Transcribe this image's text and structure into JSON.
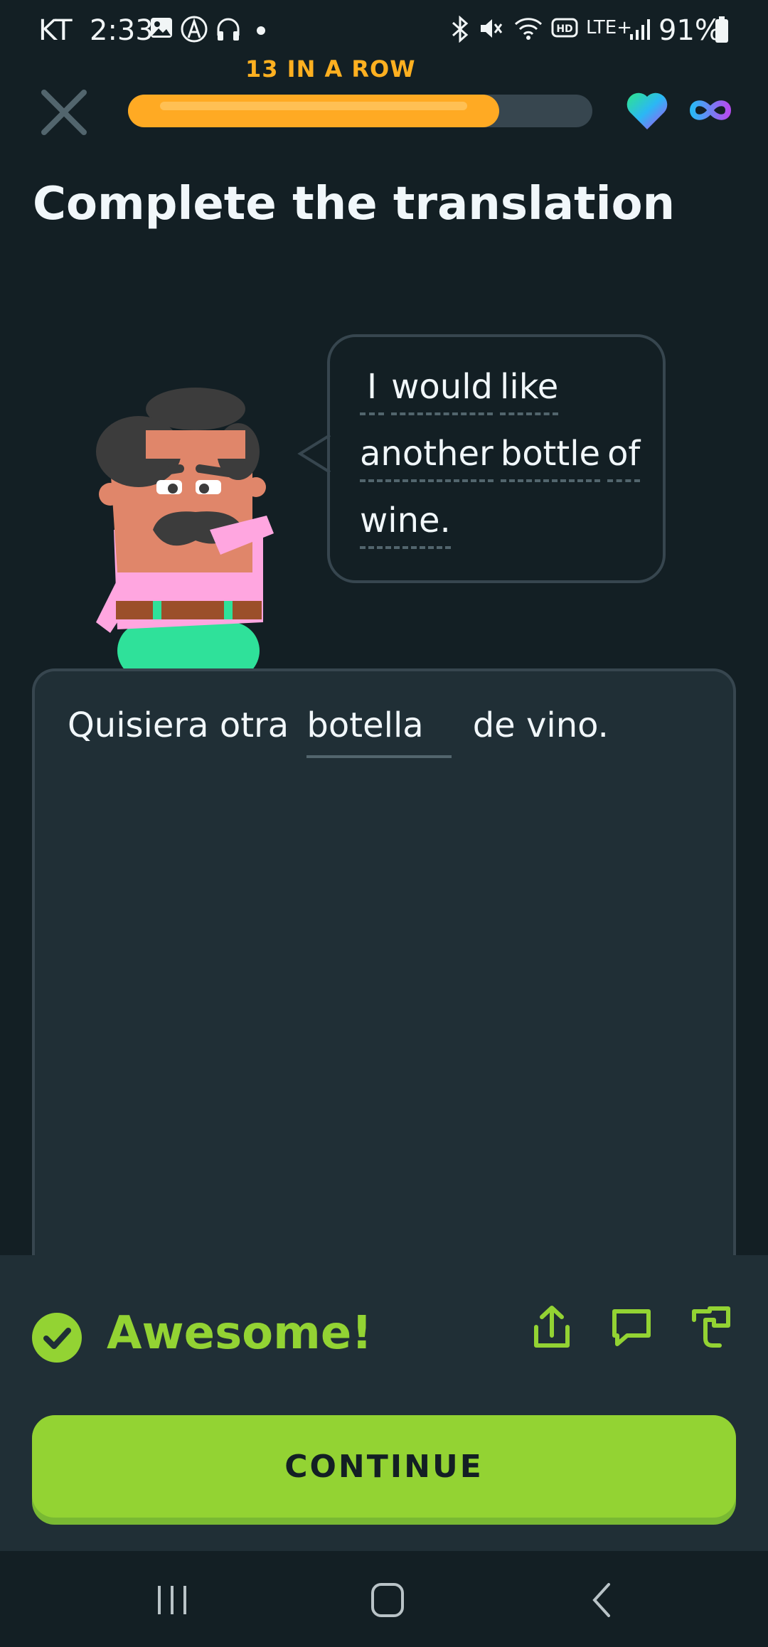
{
  "status_bar": {
    "carrier": "KT",
    "time": "2:33",
    "network": "LTE+",
    "battery": "91%"
  },
  "lesson": {
    "streak_label": "13 IN A ROW",
    "progress": 0.8,
    "hearts": "infinite"
  },
  "title": "Complete the translation",
  "prompt": {
    "lines": [
      [
        "I",
        "would",
        "like"
      ],
      [
        "another",
        "bottle",
        "of"
      ],
      [
        "wine."
      ]
    ]
  },
  "answer": {
    "before": "Quisiera otra",
    "filled": "botella",
    "after": "de vino."
  },
  "feedback": {
    "message": "Awesome!",
    "continue_label": "CONTINUE"
  },
  "colors": {
    "background": "#131f24",
    "accent_green": "#93d333",
    "streak_orange": "#ffb020"
  }
}
